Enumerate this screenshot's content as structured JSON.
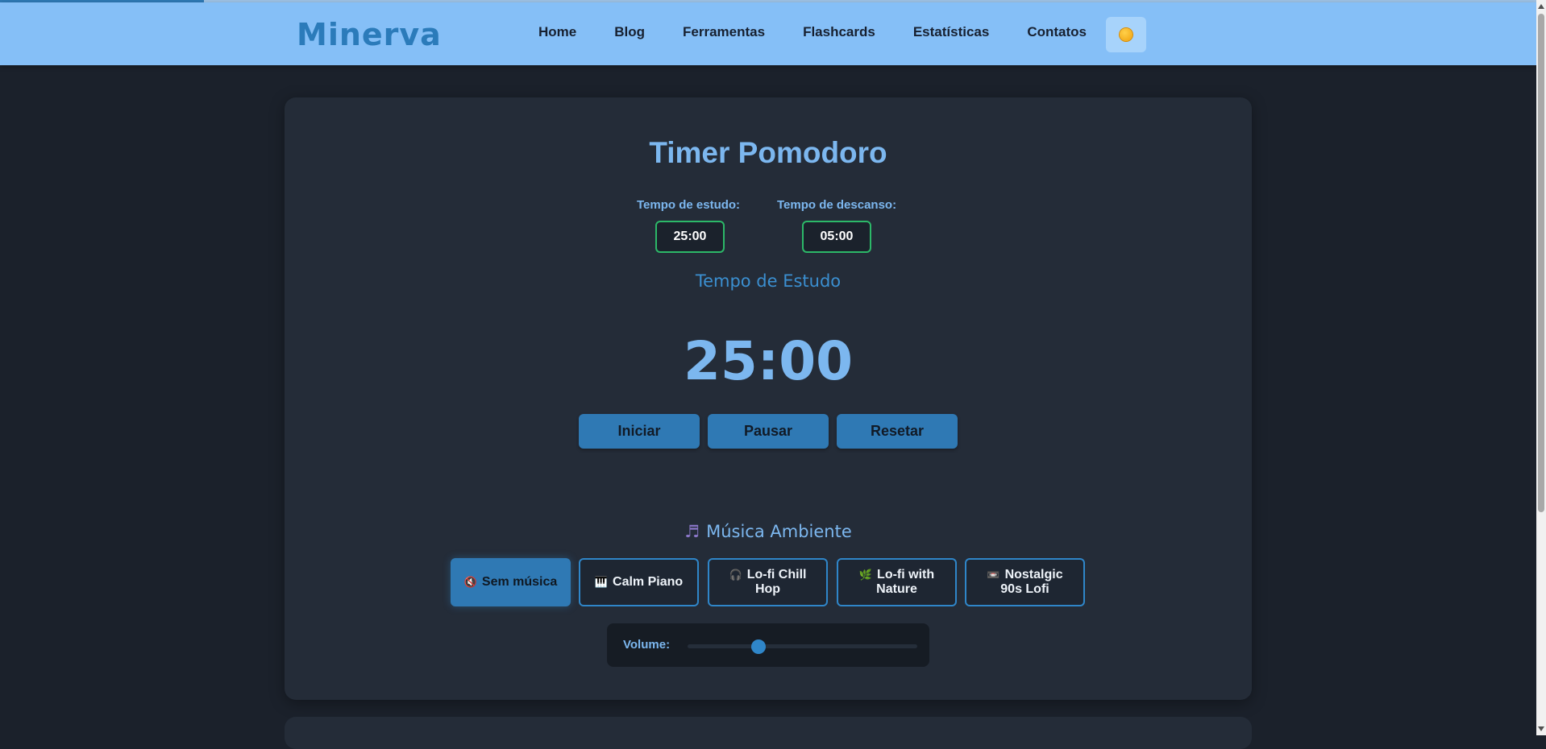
{
  "header": {
    "logo": "Minerva",
    "nav": [
      "Home",
      "Blog",
      "Ferramentas",
      "Flashcards",
      "Estatísticas",
      "Contatos"
    ],
    "theme_toggle_icon": "sun-icon"
  },
  "pomodoro": {
    "title": "Timer Pomodoro",
    "study_label": "Tempo de estudo:",
    "study_value": "25:00",
    "break_label": "Tempo de descanso:",
    "break_value": "05:00",
    "mode_label": "Tempo de Estudo",
    "timer_display": "25:00",
    "buttons": [
      "Iniciar",
      "Pausar",
      "Resetar"
    ]
  },
  "music": {
    "title": "Música Ambiente",
    "title_icon": "music-note-icon",
    "options": [
      {
        "icon": "🔇",
        "label": "Sem música",
        "active": true
      },
      {
        "icon": "🎹",
        "label": "Calm Piano",
        "active": false
      },
      {
        "icon": "🎧",
        "label": "Lo-fi Chill Hop",
        "active": false
      },
      {
        "icon": "🌿",
        "label": "Lo-fi with Nature",
        "active": false
      },
      {
        "icon": "📼",
        "label": "Nostalgic 90s Lofi",
        "active": false
      }
    ],
    "volume_label": "Volume:",
    "volume_level": 0.31
  },
  "colors": {
    "accent": "#2f79b4",
    "header_bg": "#85bff7",
    "page_bg": "#1b212b",
    "card_bg": "#242c38",
    "input_border": "#2cb868"
  }
}
